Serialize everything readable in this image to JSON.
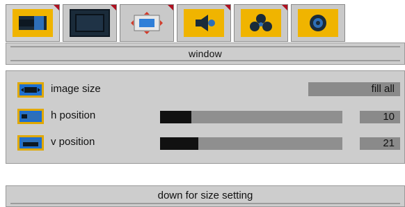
{
  "tabs": [
    {
      "icon": "aspect-ratio-icon",
      "active": true
    },
    {
      "icon": "monitor-icon",
      "active": false
    },
    {
      "icon": "position-adjust-icon",
      "active": false
    },
    {
      "icon": "speaker-icon",
      "active": false
    },
    {
      "icon": "color-icon",
      "active": false
    },
    {
      "icon": "tuning-icon",
      "active": false
    }
  ],
  "menu": {
    "title": "window"
  },
  "settings": {
    "image_size": {
      "label": "image size",
      "value": "fill all",
      "icon": "image-size-icon"
    },
    "h_position": {
      "label": "h position",
      "value": "10",
      "level_percent": 17,
      "icon": "h-position-icon"
    },
    "v_position": {
      "label": "v position",
      "value": "21",
      "level_percent": 21,
      "icon": "v-position-icon"
    }
  },
  "hint": {
    "text": "down for size setting"
  },
  "colors": {
    "accent_yellow": "#f0b400",
    "icon_blue": "#1e6fd0",
    "corner_red": "#b01020",
    "panel_gray": "#cdcdcd",
    "value_gray": "#8a8a8a"
  }
}
